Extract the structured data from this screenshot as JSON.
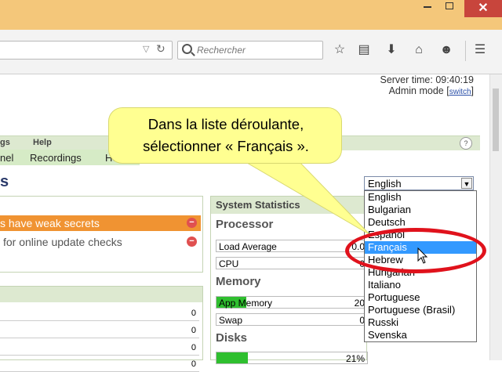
{
  "browser": {
    "search_placeholder": "Rechercher",
    "window_close": "✕"
  },
  "page": {
    "server_time": "Server time: 09:40:19",
    "admin_mode_label": "Admin mode",
    "admin_mode_link": "switch",
    "menu_top": [
      "gs",
      "Help"
    ],
    "menu_sub": [
      "nel",
      "Recordings",
      "Help"
    ],
    "help_icon": "?",
    "title_fragment": "s"
  },
  "language": {
    "selected": "English",
    "options": [
      "English",
      "Bulgarian",
      "Deutsch",
      "Español",
      "Français",
      "Hebrew",
      "Hungarian",
      "Italiano",
      "Portuguese",
      "Portuguese (Brasil)",
      "Russki",
      "Svenska"
    ],
    "highlighted": "Français"
  },
  "alerts": {
    "orange": "s have weak secrets",
    "grey": "for online update checks"
  },
  "lower_panel": {
    "rows": [
      "0",
      "0",
      "0",
      "0"
    ]
  },
  "stats": {
    "title": "System Statistics",
    "processor": "Processor",
    "load_average": "Load Average",
    "load_average_value": "0.0",
    "cpu": "CPU",
    "cpu_value": "0",
    "memory": "Memory",
    "app_memory": "App Memory",
    "app_memory_value": "20",
    "app_memory_fraction": 0.2,
    "swap": "Swap",
    "swap_value": "0",
    "disks": "Disks",
    "disk_value": "21%",
    "disk_fraction": 0.21
  },
  "callout": {
    "line1": "Dans la liste déroulante,",
    "line2": "sélectionner « Français »."
  },
  "colors": {
    "highlight": "#3399ff",
    "alert_orange": "#f09332",
    "callout_bg": "#ffff91",
    "ring": "#e0121c",
    "titlebar": "#f4c77a"
  }
}
